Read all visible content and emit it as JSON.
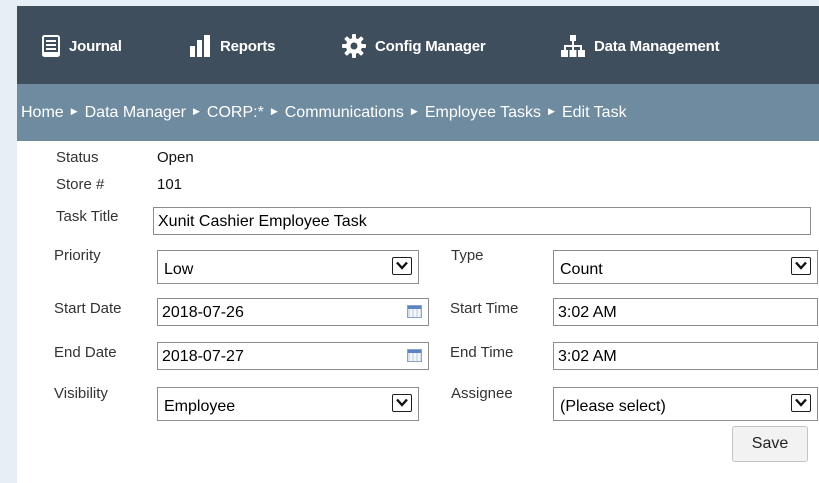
{
  "nav": {
    "items": [
      {
        "label": "Journal",
        "icon": "journal-icon"
      },
      {
        "label": "Reports",
        "icon": "bar-chart-icon"
      },
      {
        "label": "Config Manager",
        "icon": "gear-icon"
      },
      {
        "label": "Data Management",
        "icon": "sitemap-icon"
      }
    ]
  },
  "breadcrumb": {
    "items": [
      "Home",
      "Data Manager",
      "CORP:*",
      "Communications",
      "Employee Tasks",
      "Edit Task"
    ],
    "separator": "▶"
  },
  "form": {
    "status": {
      "label": "Status",
      "value": "Open"
    },
    "store": {
      "label": "Store #",
      "value": "101"
    },
    "task_title": {
      "label": "Task Title",
      "value": "Xunit Cashier Employee Task"
    },
    "priority": {
      "label": "Priority",
      "value": "Low"
    },
    "type": {
      "label": "Type",
      "value": "Count"
    },
    "start_date": {
      "label": "Start Date",
      "value": "2018-07-26"
    },
    "start_time": {
      "label": "Start Time",
      "value": "3:02 AM"
    },
    "end_date": {
      "label": "End Date",
      "value": "2018-07-27"
    },
    "end_time": {
      "label": "End Time",
      "value": "3:02 AM"
    },
    "visibility": {
      "label": "Visibility",
      "value": "Employee"
    },
    "assignee": {
      "label": "Assignee",
      "value": "(Please select)"
    },
    "save_label": "Save"
  },
  "colors": {
    "nav_bg": "#3f4e5c",
    "breadcrumb_bg": "#6e8ba0",
    "page_bg": "#e8eef6"
  }
}
